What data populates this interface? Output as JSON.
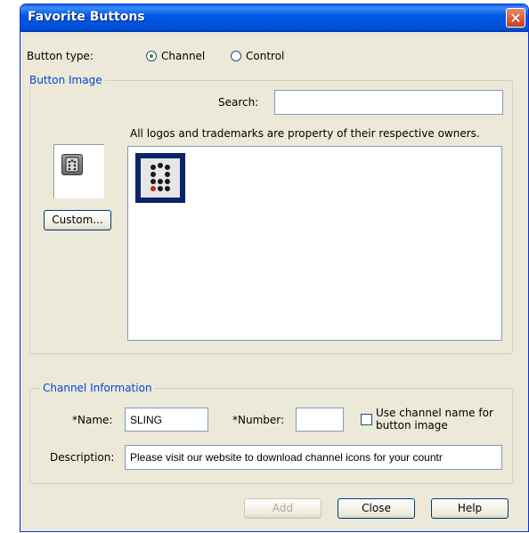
{
  "window": {
    "title": "Favorite Buttons",
    "close_glyph": "✕"
  },
  "button_type": {
    "label": "Button type:",
    "options": [
      {
        "label": "Channel",
        "selected": true
      },
      {
        "label": "Control",
        "selected": false
      }
    ]
  },
  "button_image": {
    "legend": "Button Image",
    "search_label": "Search:",
    "search_value": "",
    "disclaimer": "All logos and trademarks are property of their respective owners.",
    "custom_button": "Custom...",
    "preview_icon": "remote-control-icon",
    "logo_items": [
      {
        "icon": "remote-control-icon",
        "selected": true
      }
    ]
  },
  "channel_info": {
    "legend": "Channel Information",
    "name_label": "*Name:",
    "name_value": "SLING",
    "number_label": "*Number:",
    "number_value": "",
    "use_name_checkbox": {
      "label_line1": "Use channel name for",
      "label_line2": "button image",
      "checked": false
    },
    "description_label": "Description:",
    "description_value": "Please visit our website to download channel icons for your countr"
  },
  "footer": {
    "add": "Add",
    "close": "Close",
    "help": "Help"
  },
  "colors": {
    "title_bar": "#0058e6",
    "window_bg": "#ece9d8",
    "legend_text": "#0046d5",
    "close_button": "#d0502c"
  }
}
